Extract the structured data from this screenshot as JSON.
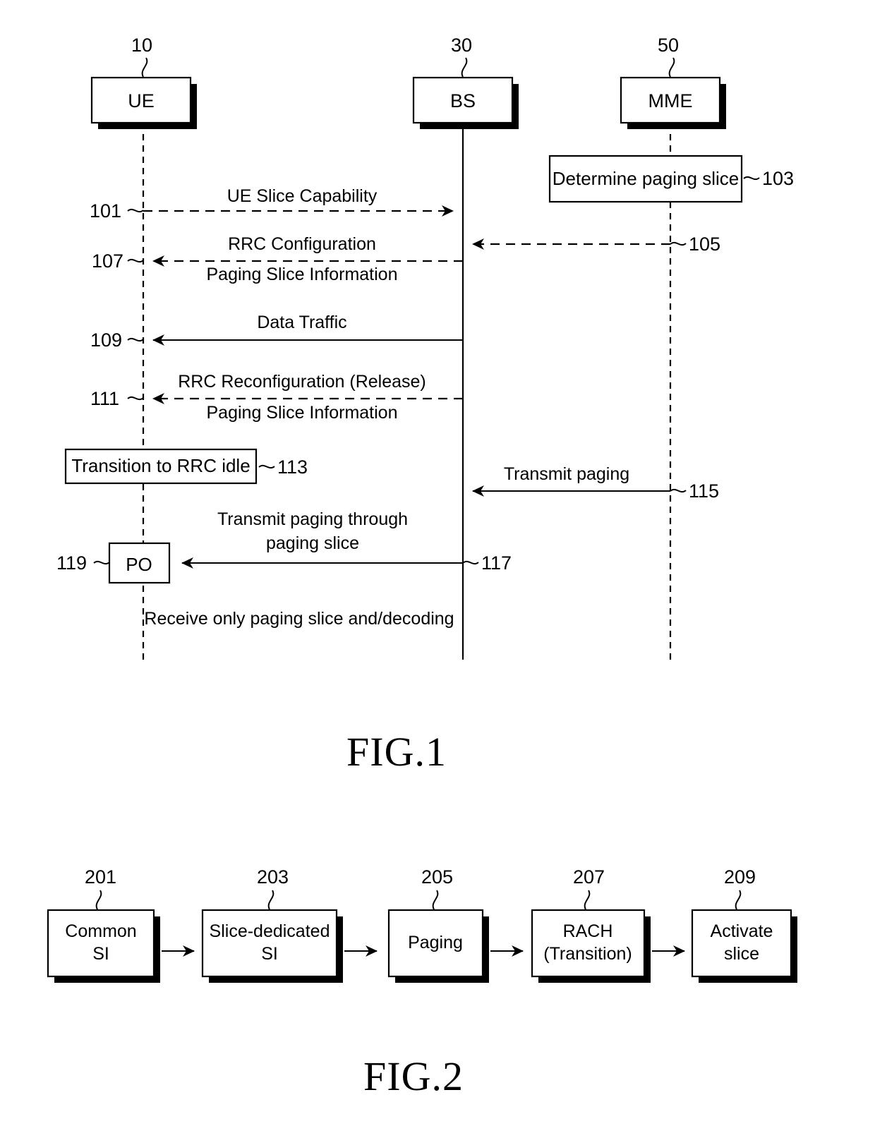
{
  "figures": [
    {
      "caption": "FIG.1",
      "type": "sequence-diagram",
      "lifelines": [
        {
          "name": "UE",
          "ref": "10"
        },
        {
          "name": "BS",
          "ref": "30"
        },
        {
          "name": "MME",
          "ref": "50"
        }
      ],
      "messages": [
        {
          "ref": "101",
          "label_above": "UE Slice Capability",
          "label_below": "",
          "from": "UE",
          "to": "BS",
          "style": "dashed"
        },
        {
          "ref": "105",
          "label_above": "",
          "label_below": "",
          "from": "MME",
          "to": "BS",
          "style": "dashed"
        },
        {
          "ref": "107",
          "label_above": "RRC Configuration",
          "label_below": "Paging Slice Information",
          "from": "BS",
          "to": "UE",
          "style": "dashed"
        },
        {
          "ref": "109",
          "label_above": "Data Traffic",
          "label_below": "",
          "from": "BS",
          "to": "UE",
          "style": "solid"
        },
        {
          "ref": "111",
          "label_above": "RRC Reconfiguration (Release)",
          "label_below": "Paging Slice Information",
          "from": "BS",
          "to": "UE",
          "style": "dashed"
        },
        {
          "ref": "115",
          "label_above": "Transmit paging",
          "label_below": "",
          "from": "MME",
          "to": "BS",
          "style": "solid"
        },
        {
          "ref": "117",
          "label_above": "Transmit paging through",
          "label_above2": "paging slice",
          "label_below": "",
          "from": "BS",
          "to": "UE",
          "style": "solid"
        }
      ],
      "process_boxes": [
        {
          "ref": "103",
          "label": "Determine paging slice",
          "on": "MME"
        },
        {
          "ref": "113",
          "label": "Transition to RRC idle",
          "on": "UE"
        },
        {
          "ref": "119",
          "label": "PO",
          "on": "UE"
        }
      ],
      "notes": [
        {
          "label": "Receive only paging slice and/decoding"
        }
      ]
    },
    {
      "caption": "FIG.2",
      "type": "flow-diagram",
      "steps": [
        {
          "ref": "201",
          "line1": "Common",
          "line2": "SI"
        },
        {
          "ref": "203",
          "line1": "Slice-dedicated",
          "line2": "SI"
        },
        {
          "ref": "205",
          "line1": "Paging",
          "line2": ""
        },
        {
          "ref": "207",
          "line1": "RACH",
          "line2": "(Transition)"
        },
        {
          "ref": "209",
          "line1": "Activate",
          "line2": "slice"
        }
      ]
    }
  ]
}
